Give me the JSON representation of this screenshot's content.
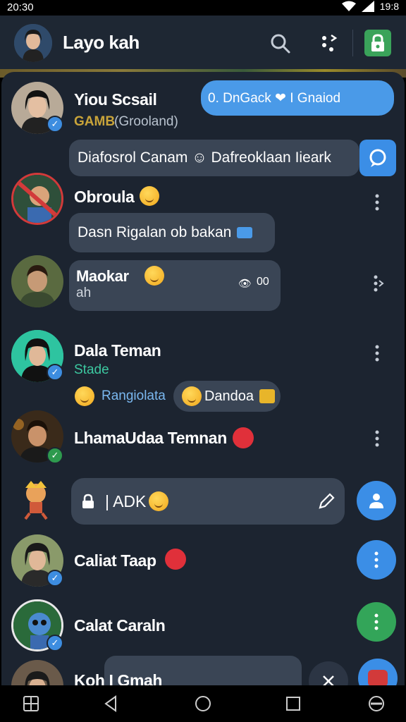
{
  "status": {
    "time": "20:30",
    "battery": "19:8"
  },
  "header": {
    "title": "Layo kah"
  },
  "chats": [
    {
      "name": "Yiou Scsail",
      "tag": "GAMB",
      "sub": "(Grooland)",
      "pill": "0. DnGack ❤ I Gnaiod",
      "preview": "Diafosrol Canam ☺ Dafreoklaan Iieark"
    },
    {
      "name": "Obroula",
      "preview": "Dasn Rigalan ob bakan"
    },
    {
      "name": "Maokar",
      "sub": "ah",
      "meta": "00"
    },
    {
      "name": "Dala Teman",
      "sub": "Stade",
      "chip1": "Rangiolata",
      "chip2": "Dandoa"
    },
    {
      "name": "LhamaUdaa Temnan"
    },
    {
      "compose": "| ADK"
    },
    {
      "name": "Caliat Taap"
    },
    {
      "name": "Calat Caraln"
    },
    {
      "name": "Koh I Gmah"
    }
  ],
  "colors": {
    "panel": "#1c2430",
    "bubble": "#3a4555",
    "accent": "#3b8ee6",
    "green": "#33a559"
  }
}
